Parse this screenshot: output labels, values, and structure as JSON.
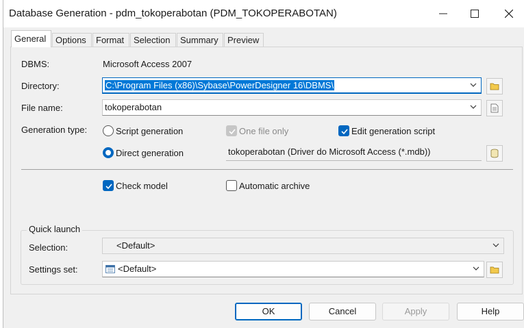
{
  "window": {
    "title": "Database Generation - pdm_tokoperabotan (PDM_TOKOPERABOTAN)"
  },
  "tabs": [
    {
      "label": "General",
      "active": true
    },
    {
      "label": "Options",
      "active": false
    },
    {
      "label": "Format",
      "active": false
    },
    {
      "label": "Selection",
      "active": false
    },
    {
      "label": "Summary",
      "active": false
    },
    {
      "label": "Preview",
      "active": false
    }
  ],
  "general": {
    "dbms_label": "DBMS:",
    "dbms_value": "Microsoft Access 2007",
    "directory_label": "Directory:",
    "directory_value": "C:\\Program Files (x86)\\Sybase\\PowerDesigner 16\\DBMS\\",
    "filename_label": "File name:",
    "filename_value": "tokoperabotan",
    "gentype_label": "Generation type:",
    "script_generation": "Script generation",
    "one_file_only": "One file only",
    "edit_generation_script": "Edit generation script",
    "direct_generation": "Direct generation",
    "datasource_value": "tokoperabotan (Driver do Microsoft Access (*.mdb))",
    "check_model": "Check model",
    "automatic_archive": "Automatic archive"
  },
  "states": {
    "script_generation_selected": false,
    "direct_generation_selected": true,
    "one_file_only_checked": true,
    "one_file_only_enabled": false,
    "edit_generation_script_checked": true,
    "check_model_checked": true,
    "automatic_archive_checked": false
  },
  "quick_launch": {
    "title": "Quick launch",
    "selection_label": "Selection:",
    "selection_value": "<Default>",
    "settings_label": "Settings set:",
    "settings_value": "<Default>"
  },
  "buttons": {
    "ok": "OK",
    "cancel": "Cancel",
    "apply": "Apply",
    "help": "Help"
  },
  "colors": {
    "accent": "#0067c0",
    "selection": "#0078d7"
  }
}
